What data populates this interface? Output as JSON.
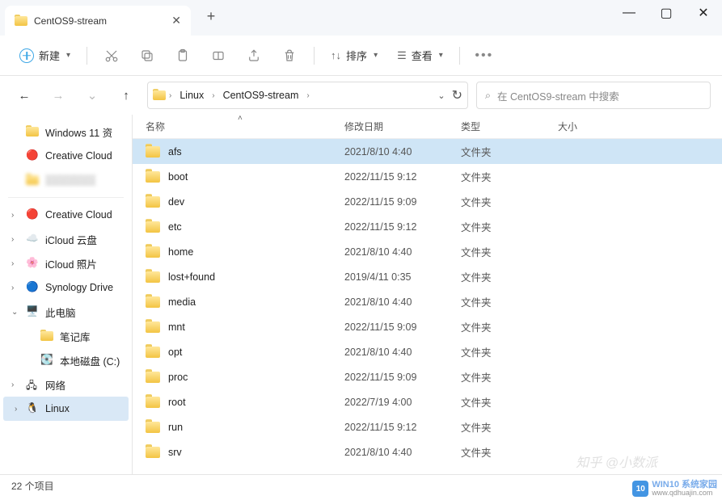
{
  "tab": {
    "title": "CentOS9-stream"
  },
  "toolbar": {
    "new_label": "新建",
    "sort_label": "排序",
    "view_label": "查看"
  },
  "breadcrumb": [
    "Linux",
    "CentOS9-stream"
  ],
  "search": {
    "placeholder": "在 CentOS9-stream 中搜索"
  },
  "columns": {
    "name": "名称",
    "date": "修改日期",
    "type": "类型",
    "size": "大小"
  },
  "folder_type": "文件夹",
  "sidebar": {
    "quick": [
      {
        "label": "Windows 11 资",
        "icon": "folder"
      },
      {
        "label": "Creative Cloud",
        "icon": "cc"
      },
      {
        "label": "░░░░░░░",
        "icon": "folder",
        "blurred": true
      }
    ],
    "tree": [
      {
        "label": "Creative Cloud",
        "icon": "cc",
        "expandable": true
      },
      {
        "label": "iCloud 云盘",
        "icon": "icloud",
        "expandable": true
      },
      {
        "label": "iCloud 照片",
        "icon": "iphoto",
        "expandable": true
      },
      {
        "label": "Synology Drive",
        "icon": "syn",
        "expandable": true
      },
      {
        "label": "此电脑",
        "icon": "pc",
        "expandable": true,
        "expanded": true,
        "children": [
          {
            "label": "笔记库",
            "icon": "folder"
          },
          {
            "label": "本地磁盘 (C:)",
            "icon": "disk"
          }
        ]
      },
      {
        "label": "网络",
        "icon": "net",
        "expandable": true
      },
      {
        "label": "Linux",
        "icon": "tux",
        "expandable": true,
        "selected": true
      }
    ]
  },
  "rows": [
    {
      "name": "afs",
      "date": "2021/8/10 4:40",
      "selected": true
    },
    {
      "name": "boot",
      "date": "2022/11/15 9:12"
    },
    {
      "name": "dev",
      "date": "2022/11/15 9:09"
    },
    {
      "name": "etc",
      "date": "2022/11/15 9:12"
    },
    {
      "name": "home",
      "date": "2021/8/10 4:40"
    },
    {
      "name": "lost+found",
      "date": "2019/4/11 0:35"
    },
    {
      "name": "media",
      "date": "2021/8/10 4:40"
    },
    {
      "name": "mnt",
      "date": "2022/11/15 9:09"
    },
    {
      "name": "opt",
      "date": "2021/8/10 4:40"
    },
    {
      "name": "proc",
      "date": "2022/11/15 9:09"
    },
    {
      "name": "root",
      "date": "2022/7/19 4:00"
    },
    {
      "name": "run",
      "date": "2022/11/15 9:12"
    },
    {
      "name": "srv",
      "date": "2021/8/10 4:40"
    }
  ],
  "status": "22 个项目",
  "watermark": {
    "line1": "WIN10 系统家园",
    "line2": "www.qdhuajin.com"
  },
  "watermark2": "知乎 @小数派"
}
